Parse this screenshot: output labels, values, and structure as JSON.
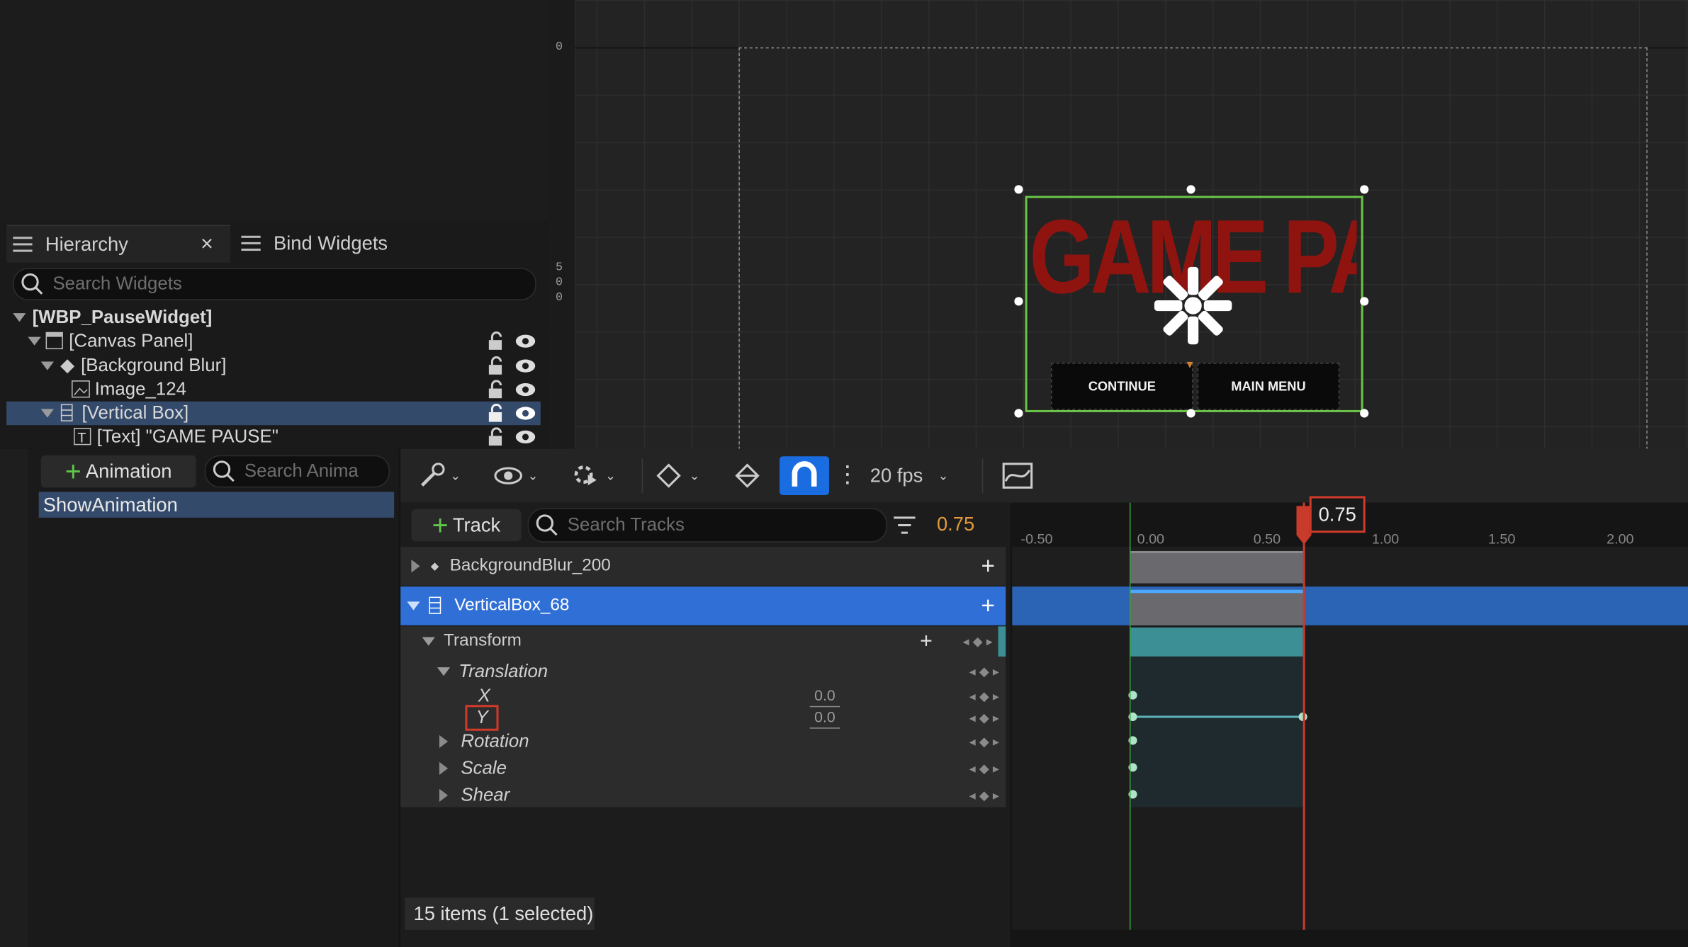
{
  "hierarchy": {
    "tab_hierarchy": "Hierarchy",
    "tab_close": "×",
    "tab_bind": "Bind Widgets",
    "search_placeholder": "Search Widgets",
    "items": [
      {
        "label": "[WBP_PauseWidget]"
      },
      {
        "label": "[Canvas Panel]"
      },
      {
        "label": "[Background Blur]"
      },
      {
        "label": "Image_124"
      },
      {
        "label": "[Vertical Box]"
      },
      {
        "label": "[Text] \"GAME PAUSE\""
      }
    ]
  },
  "viewport": {
    "ruler_marks": [
      "0",
      "5",
      "0",
      "0"
    ],
    "title_text": "GAME PAUSE",
    "buttons": [
      "CONTINUE",
      "MAIN MENU"
    ]
  },
  "animations": {
    "add_label": "Animation",
    "search_placeholder": "Search Anima",
    "items": [
      "ShowAnimation"
    ]
  },
  "sequencer": {
    "fps": "20 fps",
    "track_label": "Track",
    "search_placeholder": "Search Tracks",
    "current_time": "0.75",
    "tracks": {
      "bgblur": "BackgroundBlur_200",
      "vbox": "VerticalBox_68",
      "transform": "Transform",
      "translation": "Translation",
      "x": "X",
      "x_val": "0.0",
      "y": "Y",
      "y_val": "0.0",
      "rotation": "Rotation",
      "scale": "Scale",
      "shear": "Shear"
    },
    "status": "15 items (1 selected)",
    "ruler_ticks": [
      "-0.50",
      "0.00",
      "0.50",
      "1.00",
      "1.50",
      "2.00"
    ],
    "playhead_label": "0.75"
  },
  "colors": {
    "accent": "#1a6de0",
    "selected_row": "#2f6fd6",
    "playhead": "#c83a2a",
    "section": "#3b8f95"
  }
}
